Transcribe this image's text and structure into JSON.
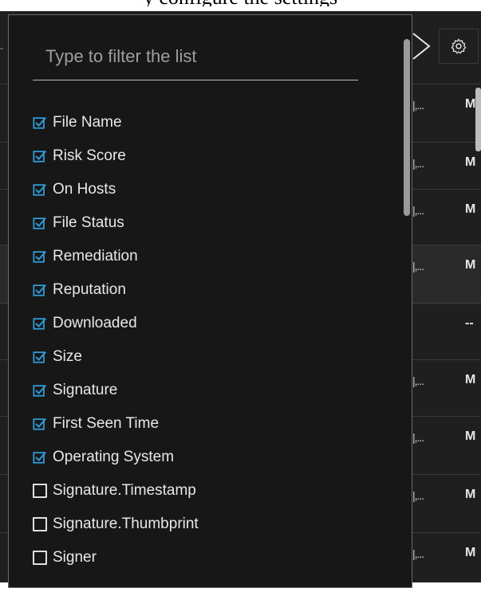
{
  "top_caption": "y configure the settings",
  "filter": {
    "placeholder": "Type to filter the list"
  },
  "columns": [
    {
      "label": "File Name",
      "checked": true
    },
    {
      "label": "Risk Score",
      "checked": true
    },
    {
      "label": "On Hosts",
      "checked": true
    },
    {
      "label": "File Status",
      "checked": true
    },
    {
      "label": "Remediation",
      "checked": true
    },
    {
      "label": "Reputation",
      "checked": true
    },
    {
      "label": "Downloaded",
      "checked": true
    },
    {
      "label": "Size",
      "checked": true
    },
    {
      "label": "Signature",
      "checked": true
    },
    {
      "label": "First Seen Time",
      "checked": true
    },
    {
      "label": "Operating System",
      "checked": true
    },
    {
      "label": "Signature.Timestamp",
      "checked": false
    },
    {
      "label": "Signature.Thumbprint",
      "checked": false
    },
    {
      "label": "Signer",
      "checked": false
    }
  ],
  "table_rows": [
    {
      "cell": "|,...",
      "value": "M"
    },
    {
      "cell": "|,...",
      "value": "M"
    },
    {
      "cell": "|,...",
      "value": "M"
    },
    {
      "cell": "|,...",
      "value": "M"
    },
    {
      "cell": "",
      "value": "--"
    },
    {
      "cell": "|,...",
      "value": "M"
    },
    {
      "cell": "|,...",
      "value": "M"
    },
    {
      "cell": "|,...",
      "value": "M"
    },
    {
      "cell": "|,...",
      "value": "M"
    }
  ],
  "colors": {
    "checkbox_checked": "#2f9bd8",
    "panel_bg": "#171717",
    "app_bg": "#1f1f1f"
  },
  "icons": {
    "toolbar_arrow": "chevron-right-outline-icon",
    "settings": "gear-icon",
    "checked": "checkbox-checked-icon",
    "unchecked": "checkbox-empty-icon"
  }
}
